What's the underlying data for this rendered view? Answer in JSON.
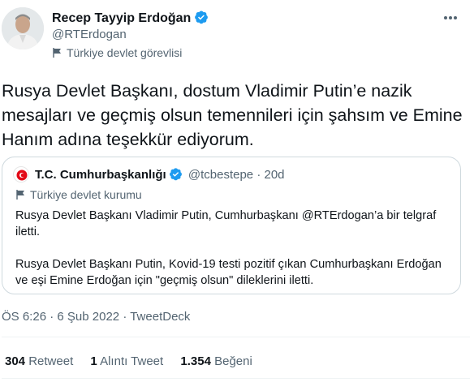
{
  "author": {
    "display_name": "Recep Tayyip Erdoğan",
    "handle": "@RTErdogan",
    "label": "Türkiye devlet görevlisi"
  },
  "tweet": {
    "text": "Rusya Devlet Başkanı, dostum Vladimir Putin’e nazik mesajları ve geçmiş olsun temennileri için şahsım ve Emine Hanım adına teşekkür ediyorum."
  },
  "quoted_tweet": {
    "display_name": "T.C. Cumhurbaşkanlığı",
    "handle": "@tcbestepe",
    "separator": "·",
    "age": "20d",
    "label": "Türkiye devlet kurumu",
    "paragraph_1": "Rusya Devlet Başkanı Vladimir Putin, Cumhurbaşkanı @RTErdogan’a bir telgraf iletti.",
    "paragraph_2": "Rusya Devlet Başkanı Putin, Kovid-19 testi pozitif çıkan Cumhurbaşkanı Erdoğan ve eşi Emine Erdoğan için \"geçmiş olsun\" dileklerini iletti."
  },
  "meta": {
    "time": "ÖS 6:26",
    "date": "6 Şub 2022",
    "source": "TweetDeck",
    "sep": "·"
  },
  "stats": {
    "retweets_count": "304",
    "retweets_label": "Retweet",
    "quotes_count": "1",
    "quotes_label": "Alıntı Tweet",
    "likes_count": "1.354",
    "likes_label": "Beğeni"
  },
  "colors": {
    "verified": "#1d9bf0",
    "secondary_text": "#536471",
    "border": "#cfd9de",
    "seal_red": "#e30a17"
  },
  "icons": {
    "verified": "verified-badge-icon",
    "flag": "flag-icon",
    "more": "more-options-icon"
  }
}
